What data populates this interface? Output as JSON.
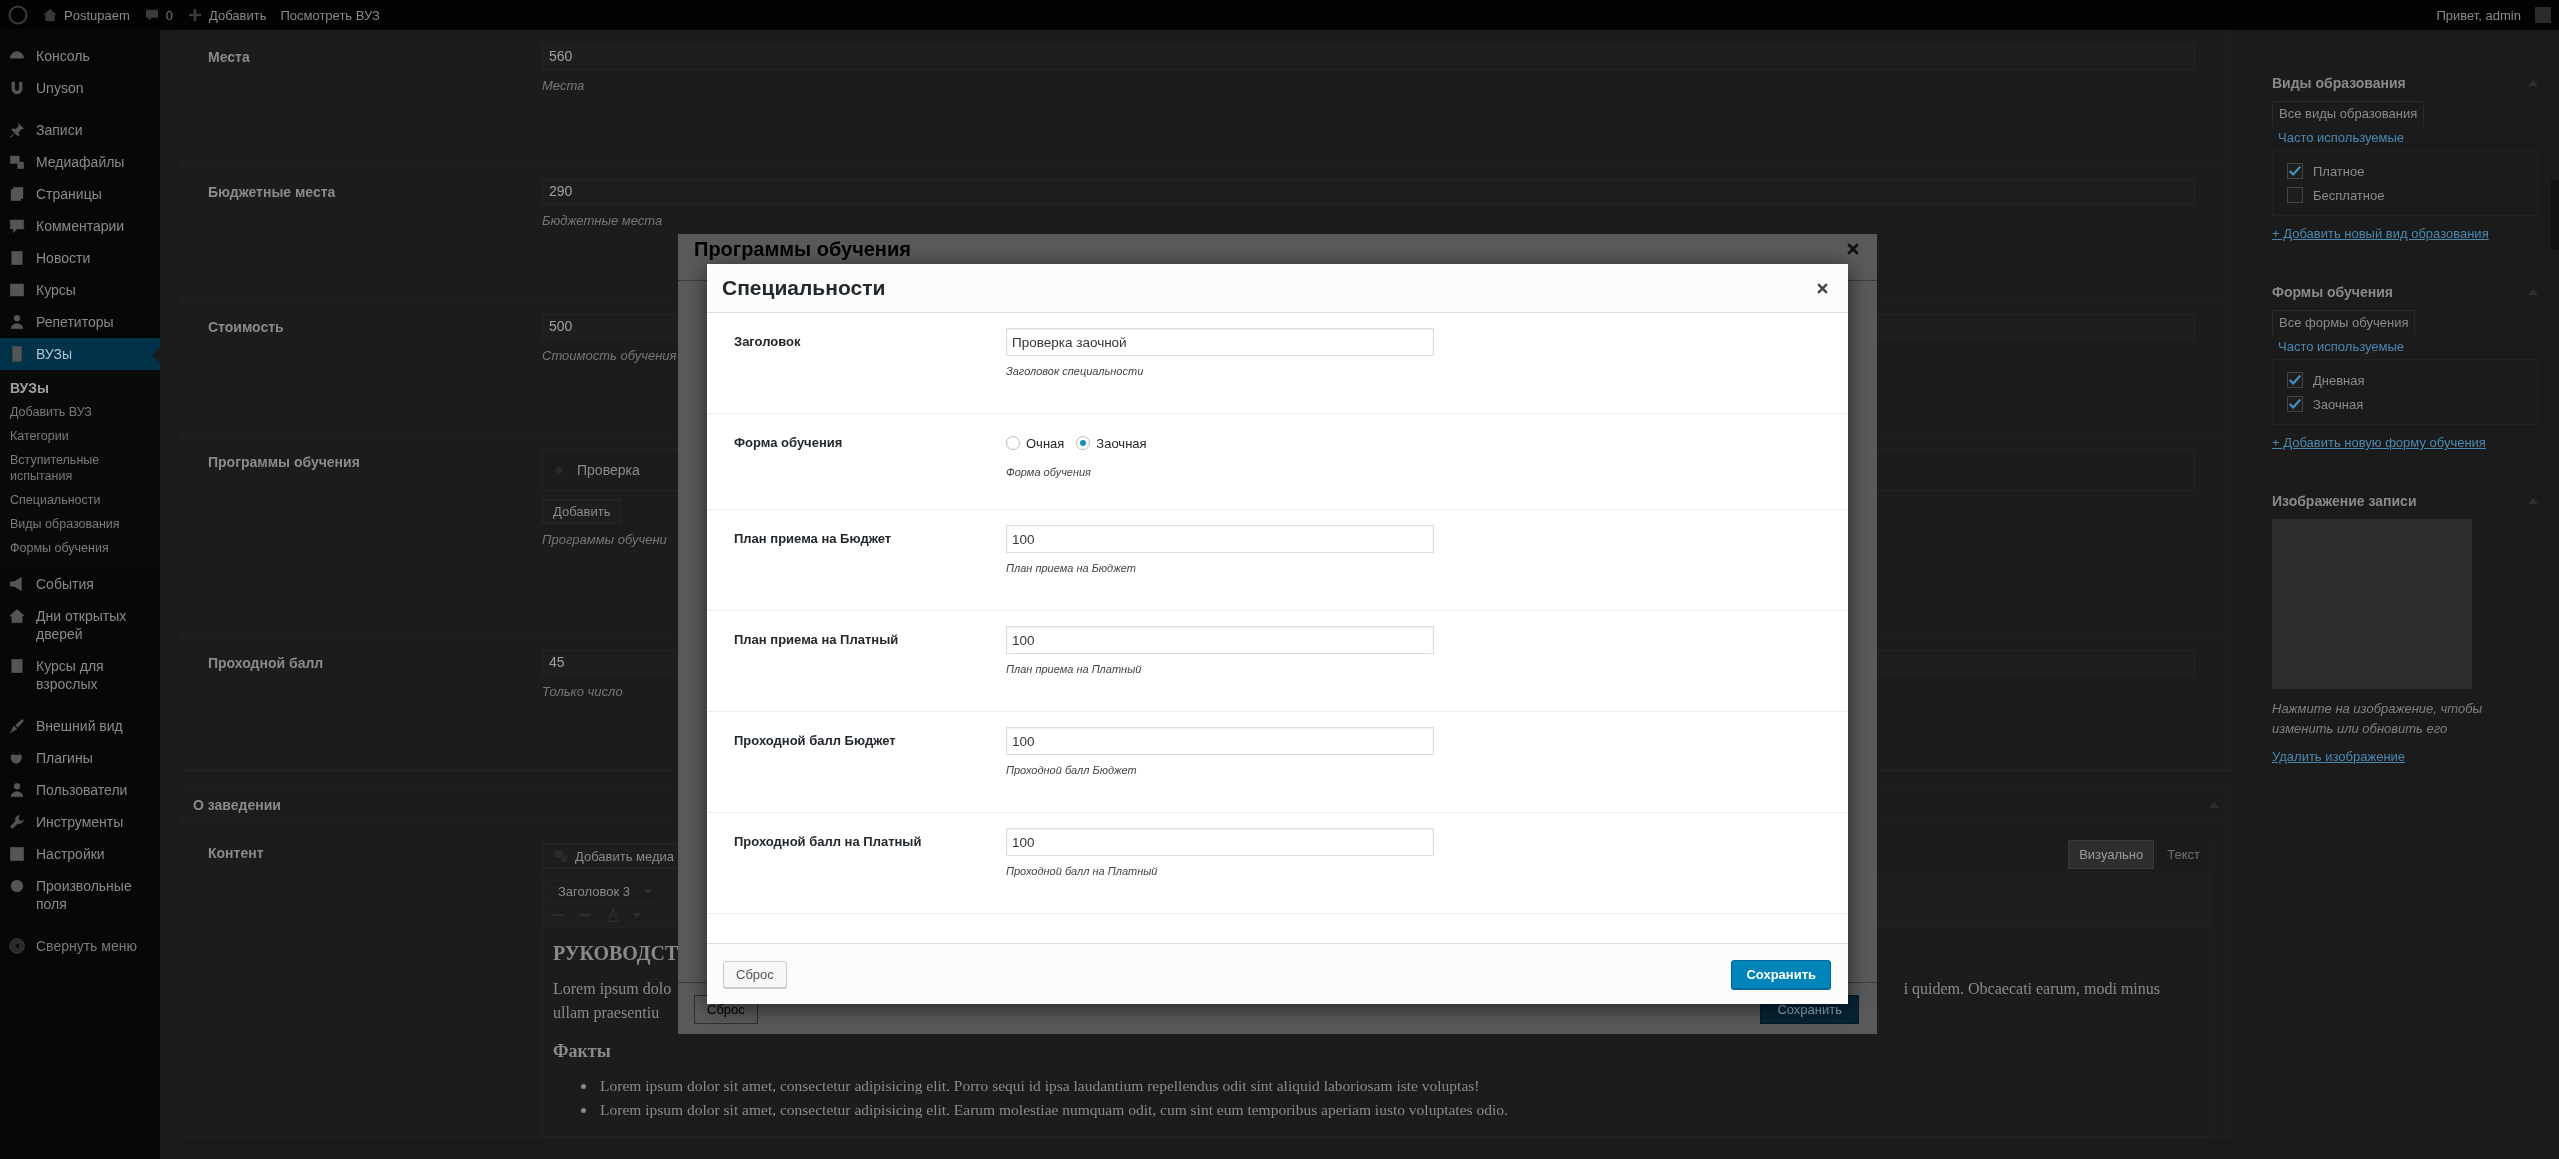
{
  "admin_bar": {
    "site": "Postupaem",
    "comments": "0",
    "add": "Добавить",
    "view": "Посмотреть ВУЗ",
    "greeting": "Привет, admin"
  },
  "sidebar": {
    "groups": [
      {
        "items": [
          {
            "label": "Консоль",
            "selected": false
          },
          {
            "label": "Unyson",
            "selected": false
          }
        ]
      },
      {
        "items": [
          {
            "label": "Записи",
            "selected": false
          },
          {
            "label": "Медиафайлы",
            "selected": false
          },
          {
            "label": "Страницы",
            "selected": false
          },
          {
            "label": "Комментарии",
            "selected": false
          },
          {
            "label": "Новости",
            "selected": false
          },
          {
            "label": "Курсы",
            "selected": false
          },
          {
            "label": "Репетиторы",
            "selected": false
          },
          {
            "label": "ВУЗы",
            "selected": true,
            "children": [
              {
                "label": "ВУЗы",
                "selected": true
              },
              {
                "label": "Добавить ВУЗ",
                "selected": false
              },
              {
                "label": "Категории",
                "selected": false
              },
              {
                "label": "Вступительные испытания",
                "selected": false
              },
              {
                "label": "Специальности",
                "selected": false
              },
              {
                "label": "Виды образования",
                "selected": false
              },
              {
                "label": "Формы обучения",
                "selected": false
              }
            ]
          },
          {
            "label": "События",
            "selected": false
          },
          {
            "label": "Дни открытых дверей",
            "selected": false
          },
          {
            "label": "Курсы для взрослых",
            "selected": false
          }
        ]
      },
      {
        "items": [
          {
            "label": "Внешний вид",
            "selected": false
          },
          {
            "label": "Плагины",
            "selected": false
          },
          {
            "label": "Пользователи",
            "selected": false
          },
          {
            "label": "Инструменты",
            "selected": false
          },
          {
            "label": "Настройки",
            "selected": false
          },
          {
            "label": "Произвольные поля",
            "selected": false
          }
        ]
      }
    ],
    "collapse": "Свернуть меню"
  },
  "fields": [
    {
      "kind": "text",
      "label": "Места",
      "value": "560",
      "hint": "Места"
    },
    {
      "kind": "text",
      "label": "Бюджетные места",
      "value": "290",
      "hint": "Бюджетные места"
    },
    {
      "kind": "text",
      "label": "Стоимость",
      "value": "500",
      "hint": "Стоимость обучения"
    },
    {
      "kind": "list",
      "label": "Программы обучения",
      "items": [
        "Проверка"
      ],
      "button": "Добавить",
      "hint": "Программы обучени"
    },
    {
      "kind": "text",
      "label": "Проходной балл",
      "value": "45",
      "hint": "Только число"
    }
  ],
  "section": {
    "title": "О заведении",
    "content_label": "Контент",
    "add_media": "Добавить медиа",
    "tabs": [
      {
        "label": "Визуально",
        "selected": true
      },
      {
        "label": "Текст",
        "selected": false
      }
    ],
    "format": "Заголовок 3",
    "heading": "РУКОВОДСТ",
    "para_left": [
      "Lorem ipsum dolo",
      "ullam praesentiu"
    ],
    "para_right": "i quidem. Obcaecati earum, modi minus",
    "subheading": "Факты",
    "bullets": [
      "Lorem ipsum dolor sit amet, consectetur adipisicing elit. Porro sequi id ipsa laudantium repellendus odit sint aliquid laboriosam iste voluptas!",
      "Lorem ipsum dolor sit amet, consectetur adipisicing elit. Earum molestiae numquam odit, cum sint eum temporibus aperiam iusto voluptates odio."
    ]
  },
  "boxes": [
    {
      "kind": "terms",
      "title": "Виды образования",
      "tabs": [
        {
          "label": "Все виды образования",
          "selected": true
        },
        {
          "label": "Часто используемые",
          "selected": false
        }
      ],
      "terms": [
        {
          "label": "Платное",
          "checked": true
        },
        {
          "label": "Бесплатное",
          "checked": false
        }
      ],
      "add_link": "+ Добавить новый вид образования"
    },
    {
      "kind": "terms",
      "title": "Формы обучения",
      "tabs": [
        {
          "label": "Все формы обучения",
          "selected": true
        },
        {
          "label": "Часто используемые",
          "selected": false
        }
      ],
      "terms": [
        {
          "label": "Дневная",
          "checked": true
        },
        {
          "label": "Заочная",
          "checked": true
        }
      ],
      "add_link": "+ Добавить новую форму обучения"
    },
    {
      "kind": "image",
      "title": "Изображение записи",
      "hint": "Нажмите на изображение, чтобы изменить или обновить его",
      "remove_link": "Удалить изображение"
    }
  ],
  "back_modal": {
    "title": "Программы обучения",
    "reset": "Сброс",
    "save": "Сохранить"
  },
  "modal": {
    "title": "Специальности",
    "fields": [
      {
        "kind": "text",
        "label": "Заголовок",
        "value": "Проверка заочной",
        "hint": "Заголовок специальности"
      },
      {
        "kind": "radio",
        "label": "Форма обучения",
        "options": [
          {
            "label": "Очная",
            "selected": false
          },
          {
            "label": "Заочная",
            "selected": true
          }
        ],
        "hint": "Форма обучения"
      },
      {
        "kind": "text",
        "label": "План приема на Бюджет",
        "value": "100",
        "hint": "План приема на Бюджет"
      },
      {
        "kind": "text",
        "label": "План приема на Платный",
        "value": "100",
        "hint": "План приема на Платный"
      },
      {
        "kind": "text",
        "label": "Проходной балл Бюджет",
        "value": "100",
        "hint": "Проходной балл Бюджет"
      },
      {
        "kind": "text",
        "label": "Проходной балл на Платный",
        "value": "100",
        "hint": "Проходной балл на Платный"
      }
    ],
    "reset": "Сброс",
    "save": "Сохранить"
  }
}
